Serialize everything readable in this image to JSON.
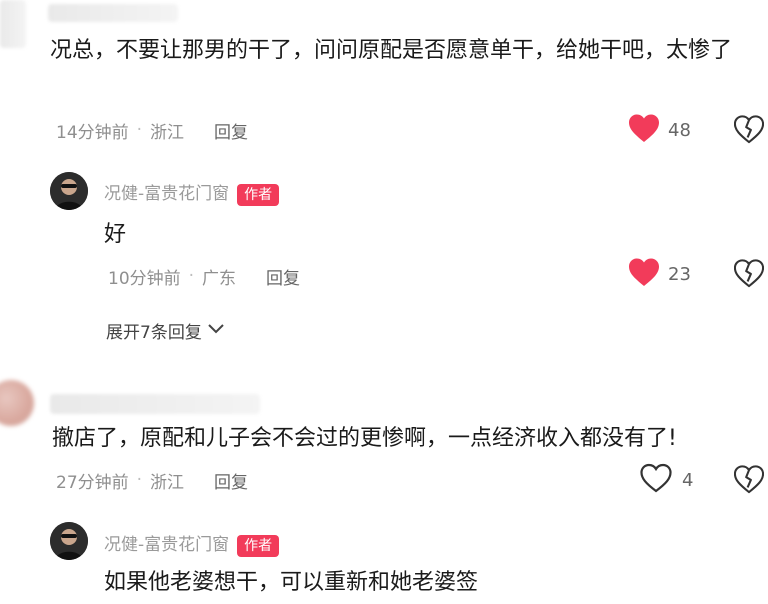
{
  "comments": [
    {
      "text": "况总，不要让那男的干了，问问原配是否愿意单干，给她干吧，太惨了",
      "time": "14分钟前",
      "location": "浙江",
      "reply_label": "回复",
      "likes": "48",
      "liked": true
    },
    {
      "text": "撤店了，原配和儿子会不会过的更惨啊，一点经济收入都没有了!",
      "time": "27分钟前",
      "location": "浙江",
      "reply_label": "回复",
      "likes": "4",
      "liked": false
    }
  ],
  "replies": [
    {
      "author": "况健-富贵花门窗",
      "badge": "作者",
      "text": "好",
      "time": "10分钟前",
      "location": "广东",
      "reply_label": "回复",
      "likes": "23",
      "liked": true
    },
    {
      "author": "况健-富贵花门窗",
      "badge": "作者",
      "text": "如果他老婆想干，可以重新和她老婆签"
    }
  ],
  "expand_label": "展开7条回复",
  "colors": {
    "like": "#f23b5a",
    "badge": "#f23b5a",
    "meta": "#8f8f8f"
  }
}
